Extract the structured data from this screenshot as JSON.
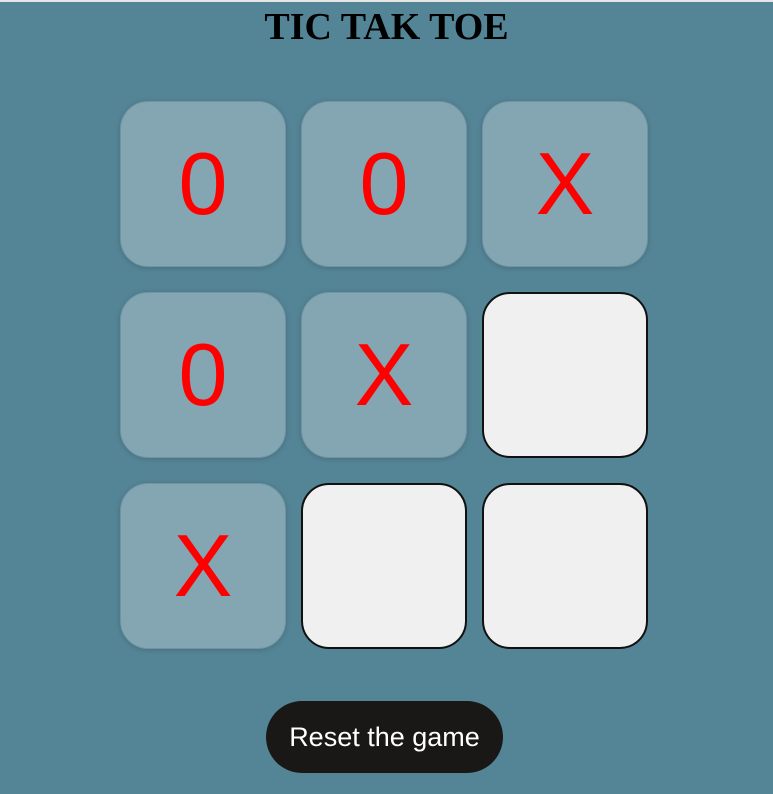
{
  "title": "TIC TAK TOE",
  "colors": {
    "background": "#548597",
    "played_cell": "#84a6b2",
    "empty_cell": "#f0f0f0",
    "mark": "#ff0000",
    "button": "#191816",
    "button_text": "#ffffff"
  },
  "board": {
    "cells": [
      {
        "mark": "0"
      },
      {
        "mark": "0"
      },
      {
        "mark": "X"
      },
      {
        "mark": "0"
      },
      {
        "mark": "X"
      },
      {
        "mark": ""
      },
      {
        "mark": "X"
      },
      {
        "mark": ""
      },
      {
        "mark": ""
      }
    ]
  },
  "reset_label": "Reset the game"
}
